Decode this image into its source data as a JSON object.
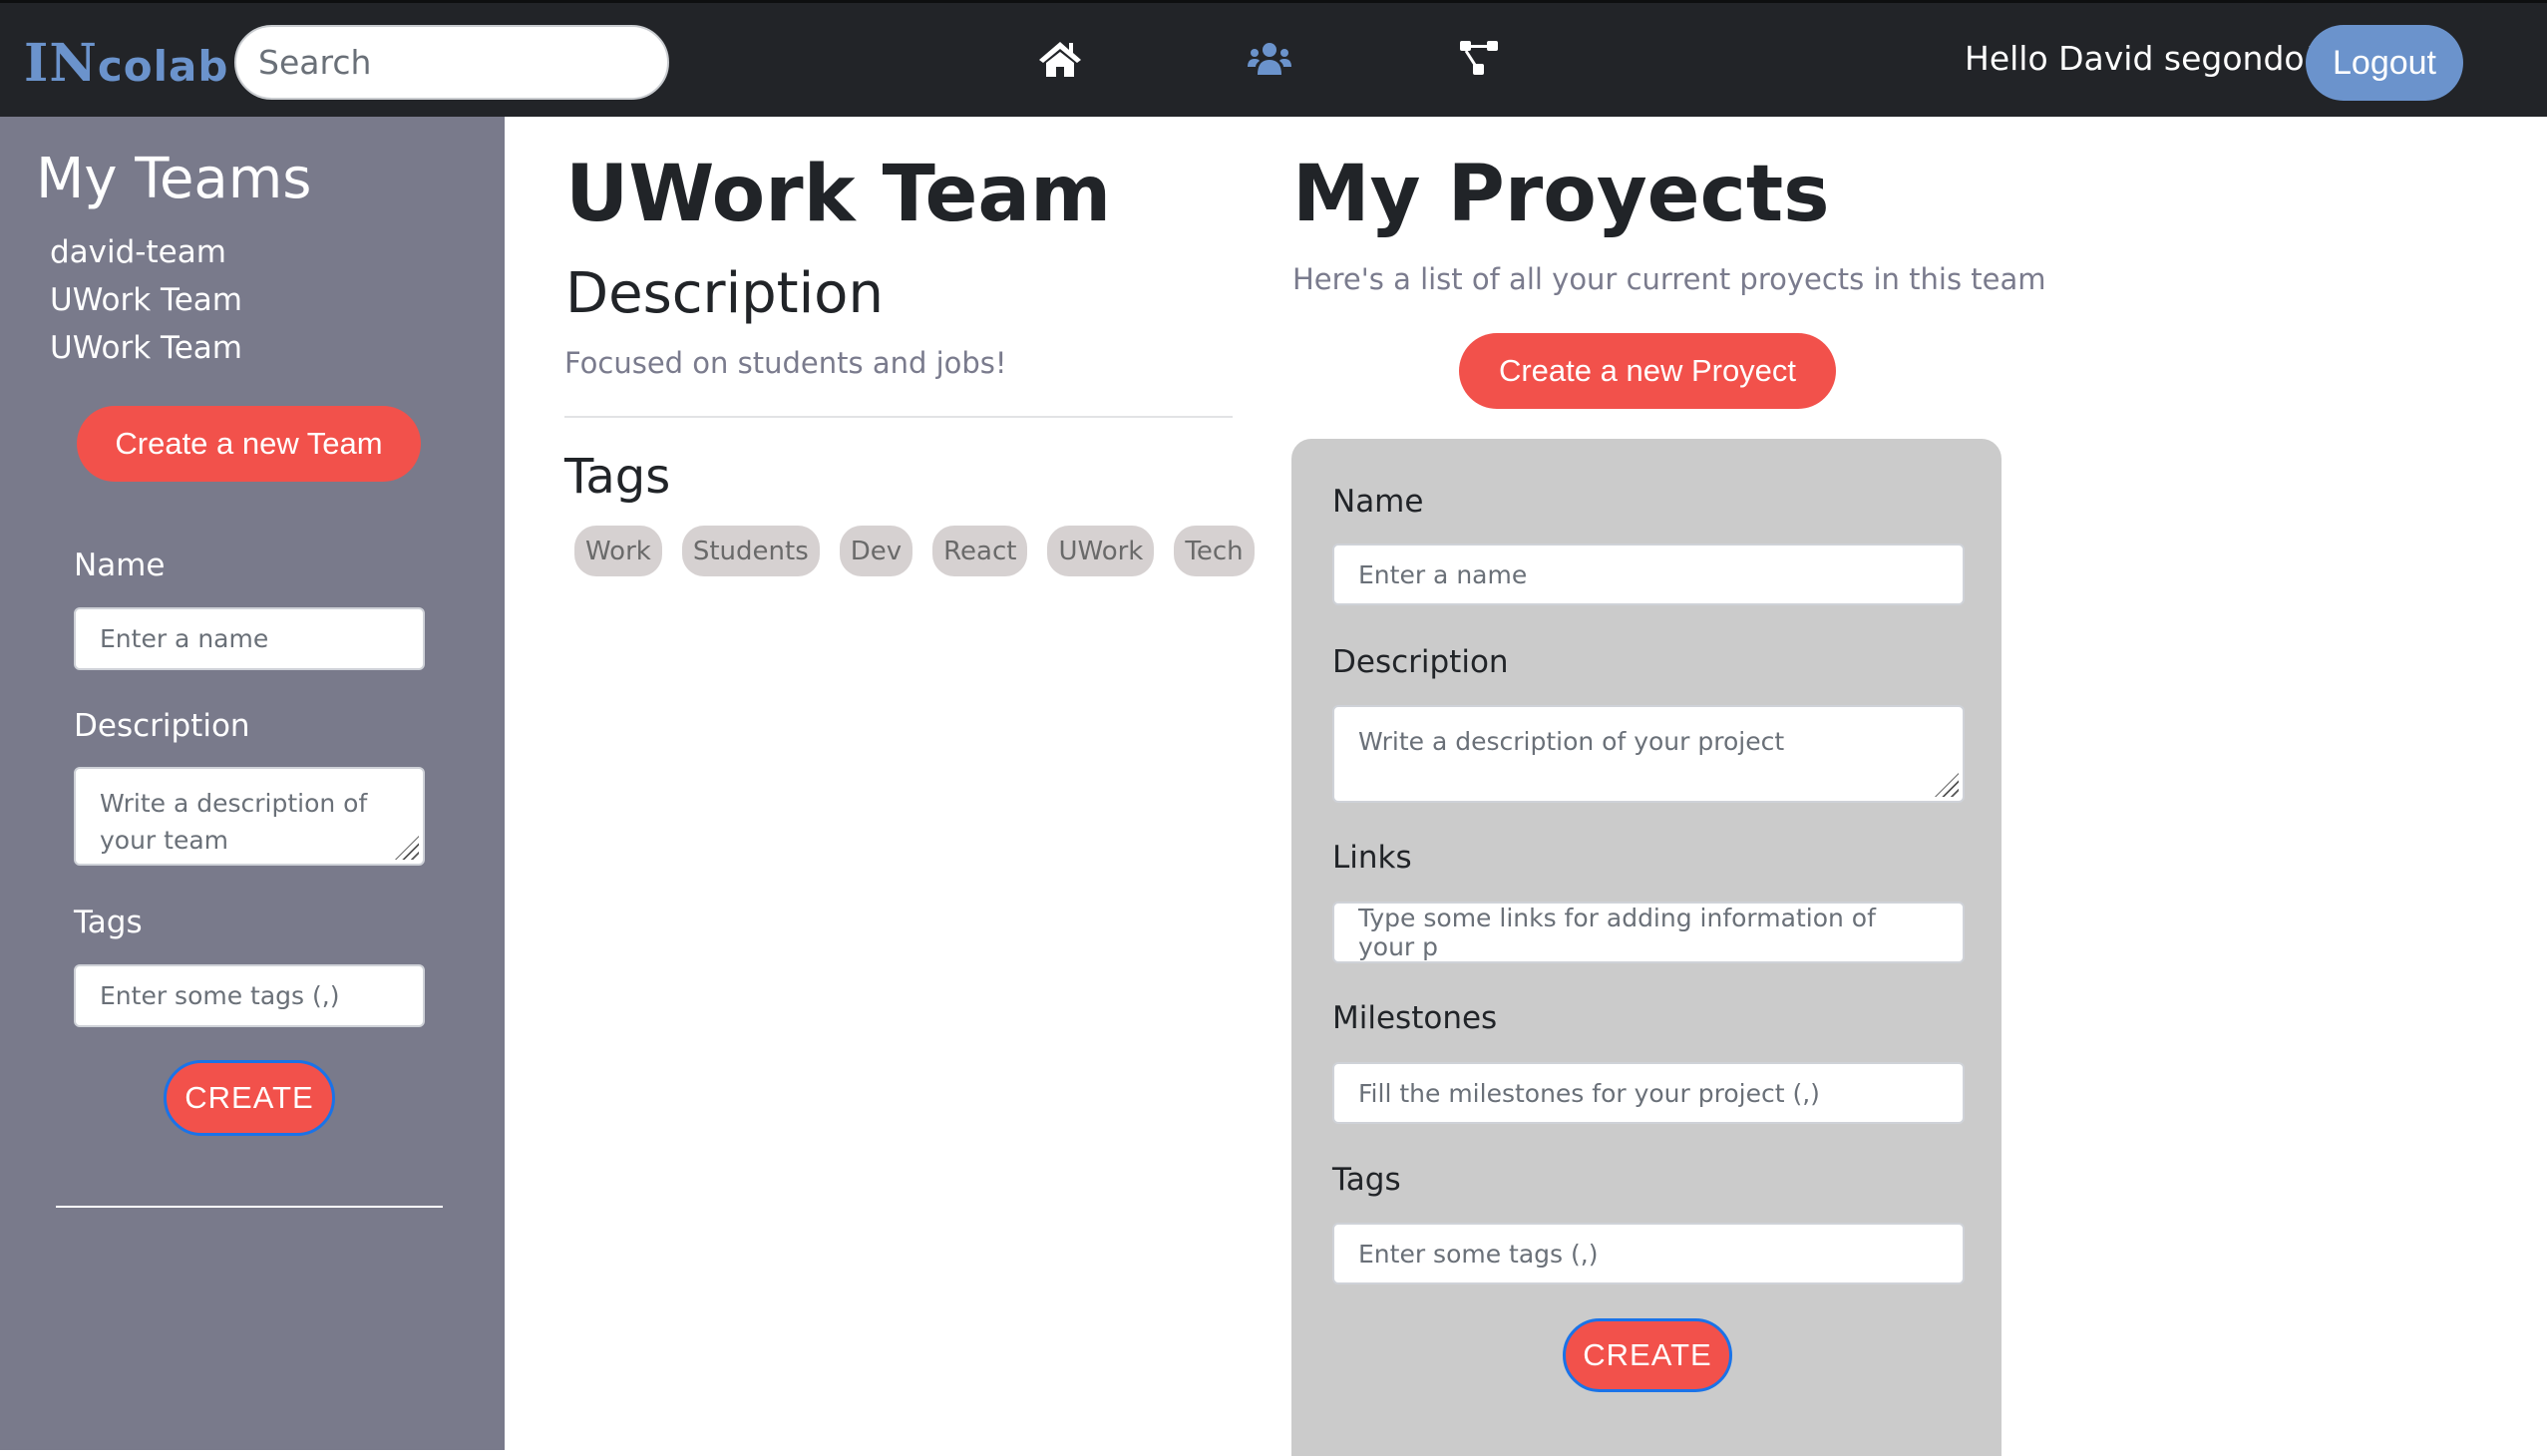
{
  "navbar": {
    "logo_prefix": "IN",
    "logo_suffix": "colab",
    "search_placeholder": "Search",
    "icons": [
      "home-icon",
      "users-icon",
      "project-diagram-icon"
    ],
    "active_icon": "users-icon",
    "greeting": "Hello David segondo!",
    "logout_label": "Logout"
  },
  "sidebar": {
    "title": "My Teams",
    "teams": [
      "david-team",
      "UWork Team",
      "UWork Team"
    ],
    "new_team_label": "Create a new Team",
    "form": {
      "name_label": "Name",
      "name_placeholder": "Enter a name",
      "description_label": "Description",
      "description_placeholder": "Write a description of your team",
      "tags_label": "Tags",
      "tags_placeholder": "Enter some tags (,)",
      "create_label": "CREATE"
    }
  },
  "team": {
    "title": "UWork Team",
    "description_heading": "Description",
    "description": "Focused on students and jobs!",
    "tags_heading": "Tags",
    "tags": [
      "Work",
      "Students",
      "Dev",
      "React",
      "UWork",
      "Tech"
    ]
  },
  "projects": {
    "title": "My Proyects",
    "subtitle": "Here's a list of all your current proyects in this team",
    "new_project_label": "Create a new Proyect",
    "form": {
      "name_label": "Name",
      "name_placeholder": "Enter a name",
      "description_label": "Description",
      "description_placeholder": "Write a description of your project",
      "links_label": "Links",
      "links_placeholder": "Type some links for adding information of your p",
      "milestones_label": "Milestones",
      "milestones_placeholder": "Fill the milestones for your project (,)",
      "tags_label": "Tags",
      "tags_placeholder": "Enter some tags (,)",
      "create_label": "CREATE"
    }
  },
  "colors": {
    "navbar_bg": "#222428",
    "accent_blue": "#6b93cc",
    "accent_red": "#f2514b",
    "sidebar_bg": "#797a8b",
    "card_bg": "#cbcbcb",
    "tag_bg": "#d6d1d1"
  }
}
